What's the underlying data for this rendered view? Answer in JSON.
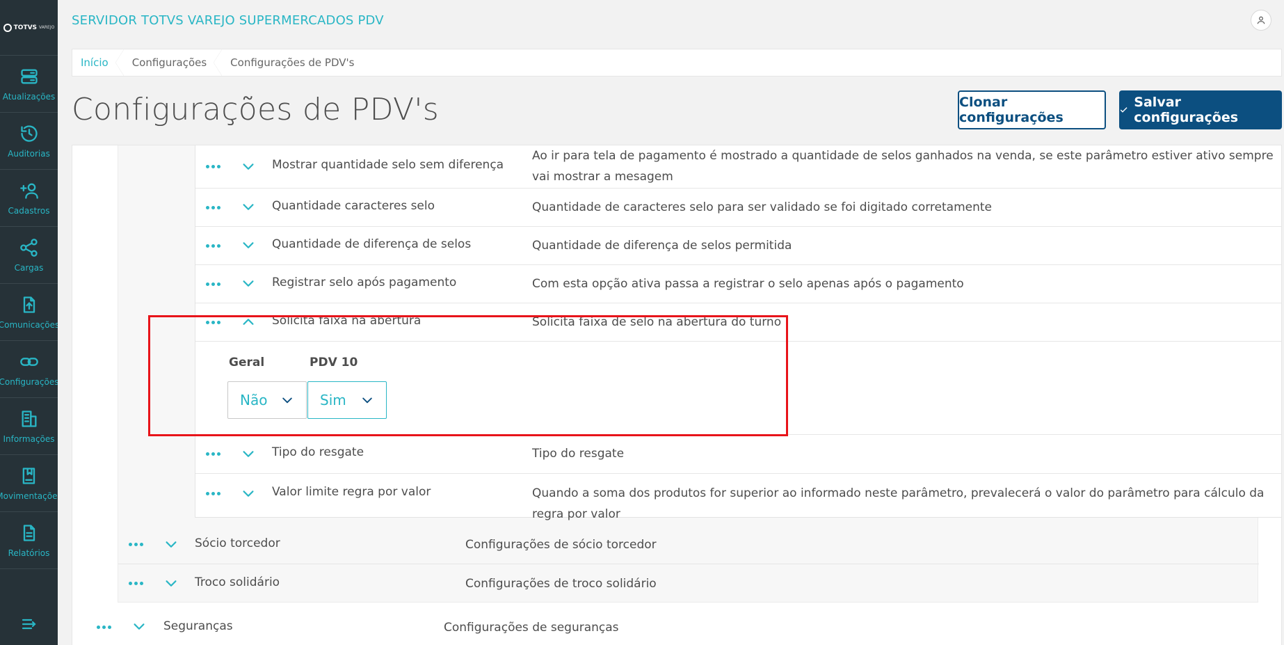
{
  "app": {
    "title": "SERVIDOR TOTVS VAREJO SUPERMERCADOS PDV",
    "logo_text": "TOTVS",
    "logo_sub": "VAREJO"
  },
  "sidebar": {
    "items": [
      {
        "label": "Atualizações",
        "icon": "server-icon"
      },
      {
        "label": "Auditorias",
        "icon": "history-icon"
      },
      {
        "label": "Cadastros",
        "icon": "add-user-icon"
      },
      {
        "label": "Cargas",
        "icon": "share-icon"
      },
      {
        "label": "Comunicações",
        "icon": "upload-file-icon"
      },
      {
        "label": "Configurações",
        "icon": "link-icon"
      },
      {
        "label": "Informações",
        "icon": "building-icon"
      },
      {
        "label": "Movimentações",
        "icon": "book-icon"
      },
      {
        "label": "Relatórios",
        "icon": "document-icon"
      }
    ]
  },
  "breadcrumb": [
    "Início",
    "Configurações",
    "Configurações de PDV's"
  ],
  "page": {
    "title": "Configurações de PDV's",
    "clone_label": "Clonar configurações",
    "save_label": "Salvar configurações"
  },
  "params": [
    {
      "name": "Mostrar quantidade selo sem diferença",
      "desc": "Ao ir para tela de pagamento é mostrado a quantidade de selos ganhados na venda, se este parâmetro estiver ativo sempre vai mostrar a mesagem"
    },
    {
      "name": "Quantidade caracteres selo",
      "desc": "Quantidade de caracteres selo para ser validado se foi digitado corretamente"
    },
    {
      "name": "Quantidade de diferença de selos",
      "desc": "Quantidade de diferença de selos permitida"
    },
    {
      "name": "Registrar selo após pagamento",
      "desc": "Com esta opção ativa passa a registrar o selo apenas após o pagamento"
    },
    {
      "name": "Solicita faixa na abertura",
      "desc": "Solicita faixa de selo na abertura do turno"
    },
    {
      "name": "Tipo do resgate",
      "desc": "Tipo do resgate"
    },
    {
      "name": "Valor limite regra por valor",
      "desc": "Quando a soma dos produtos for superior ao informado neste parâmetro, prevalecerá o valor do parâmetro para cálculo da regra por valor"
    }
  ],
  "expanded": {
    "geral_label": "Geral",
    "pdv_label": "PDV 10",
    "geral_value": "Não",
    "pdv_value": "Sim"
  },
  "groups": [
    {
      "name": "Sócio torcedor",
      "desc": "Configurações de sócio torcedor"
    },
    {
      "name": "Troco solidário",
      "desc": "Configurações de troco solidário"
    }
  ],
  "top_group": {
    "name": "Seguranças",
    "desc": "Configurações de seguranças"
  },
  "colors": {
    "accent": "#29b6c5",
    "primary": "#0c4f80",
    "sidebar": "#263238",
    "highlight": "#e8141a"
  }
}
